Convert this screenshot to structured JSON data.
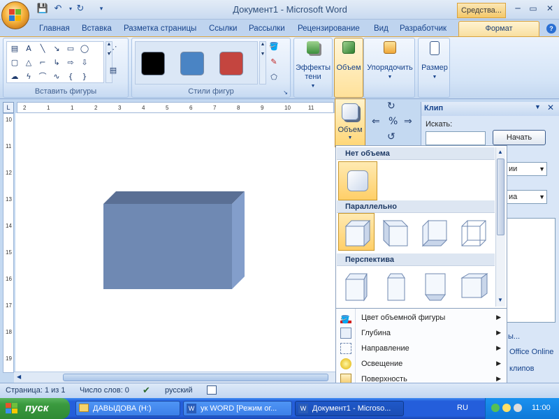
{
  "window": {
    "title": "Документ1 - Microsoft Word",
    "context_tab_title": "Средства...",
    "min": "─",
    "max": "▭",
    "close": "✕"
  },
  "tabs": [
    "Главная",
    "Вставка",
    "Разметка страницы",
    "Ссылки",
    "Рассылки",
    "Рецензирование",
    "Вид",
    "Разработчик"
  ],
  "active_tab": "Формат",
  "ribbon": {
    "insert_shapes_label": "Вставить фигуры",
    "shape_styles_label": "Стили фигур",
    "style_colors": [
      "#000000",
      "#4a84c4",
      "#c4453f"
    ],
    "shadow_effects_label": "Эффекты тени",
    "shadow_line1": "Эффекты",
    "shadow_line2": "тени",
    "volume_label": "Объем",
    "arrange_label": "Упорядочить",
    "size_label": "Размер"
  },
  "ruler": {
    "h_ticks": [
      "2",
      "1",
      "1",
      "2",
      "3",
      "4",
      "5",
      "6",
      "7",
      "8",
      "9",
      "10",
      "11"
    ],
    "v_ticks": [
      "10",
      "11",
      "12",
      "13",
      "14",
      "15",
      "16",
      "17",
      "18",
      "19"
    ]
  },
  "volume_dropdown": {
    "button_label": "Объем",
    "sections": [
      "Нет объема",
      "Параллельно",
      "Перспектива"
    ],
    "menu": [
      {
        "label": "Цвет объемной фигуры",
        "icon": "paint-bucket-icon"
      },
      {
        "label": "Глубина",
        "icon": "depth-icon"
      },
      {
        "label": "Направление",
        "icon": "direction-icon"
      },
      {
        "label": "Освещение",
        "icon": "lighting-icon"
      },
      {
        "label": "Поверхность",
        "icon": "surface-icon"
      }
    ]
  },
  "clip_panel": {
    "title": "Клип",
    "search_label": "Искать:",
    "search_value": "",
    "start_button": "Начать",
    "select1": "ии",
    "select2": "иа",
    "link_partial": "ы...",
    "office_online": "Office Online",
    "clips_partial": "клипов"
  },
  "status": {
    "page": "Страница: 1 из 1",
    "words": "Число слов: 0",
    "language": "русский"
  },
  "taskbar": {
    "start": "пуск",
    "items": [
      "ДАВЫДОВА (H:)",
      "ук WORD [Режим ог...",
      "Документ1 - Microso..."
    ],
    "lang": "RU",
    "time": "11:00"
  },
  "colors": {
    "shape_fill": "#6f89b3",
    "shape_side": "#839ecb",
    "shape_top": "#5a6f94",
    "accent": "#f5c24a"
  }
}
